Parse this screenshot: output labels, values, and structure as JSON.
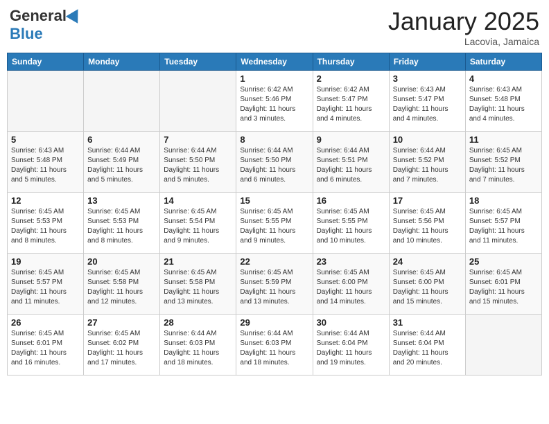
{
  "header": {
    "logo_general": "General",
    "logo_blue": "Blue",
    "month_title": "January 2025",
    "location": "Lacovia, Jamaica"
  },
  "days_of_week": [
    "Sunday",
    "Monday",
    "Tuesday",
    "Wednesday",
    "Thursday",
    "Friday",
    "Saturday"
  ],
  "weeks": [
    [
      {
        "day": "",
        "empty": true
      },
      {
        "day": "",
        "empty": true
      },
      {
        "day": "",
        "empty": true
      },
      {
        "day": "1",
        "sunrise": "6:42 AM",
        "sunset": "5:46 PM",
        "daylight": "11 hours and 3 minutes."
      },
      {
        "day": "2",
        "sunrise": "6:42 AM",
        "sunset": "5:47 PM",
        "daylight": "11 hours and 4 minutes."
      },
      {
        "day": "3",
        "sunrise": "6:43 AM",
        "sunset": "5:47 PM",
        "daylight": "11 hours and 4 minutes."
      },
      {
        "day": "4",
        "sunrise": "6:43 AM",
        "sunset": "5:48 PM",
        "daylight": "11 hours and 4 minutes."
      }
    ],
    [
      {
        "day": "5",
        "sunrise": "6:43 AM",
        "sunset": "5:48 PM",
        "daylight": "11 hours and 5 minutes."
      },
      {
        "day": "6",
        "sunrise": "6:44 AM",
        "sunset": "5:49 PM",
        "daylight": "11 hours and 5 minutes."
      },
      {
        "day": "7",
        "sunrise": "6:44 AM",
        "sunset": "5:50 PM",
        "daylight": "11 hours and 5 minutes."
      },
      {
        "day": "8",
        "sunrise": "6:44 AM",
        "sunset": "5:50 PM",
        "daylight": "11 hours and 6 minutes."
      },
      {
        "day": "9",
        "sunrise": "6:44 AM",
        "sunset": "5:51 PM",
        "daylight": "11 hours and 6 minutes."
      },
      {
        "day": "10",
        "sunrise": "6:44 AM",
        "sunset": "5:52 PM",
        "daylight": "11 hours and 7 minutes."
      },
      {
        "day": "11",
        "sunrise": "6:45 AM",
        "sunset": "5:52 PM",
        "daylight": "11 hours and 7 minutes."
      }
    ],
    [
      {
        "day": "12",
        "sunrise": "6:45 AM",
        "sunset": "5:53 PM",
        "daylight": "11 hours and 8 minutes."
      },
      {
        "day": "13",
        "sunrise": "6:45 AM",
        "sunset": "5:53 PM",
        "daylight": "11 hours and 8 minutes."
      },
      {
        "day": "14",
        "sunrise": "6:45 AM",
        "sunset": "5:54 PM",
        "daylight": "11 hours and 9 minutes."
      },
      {
        "day": "15",
        "sunrise": "6:45 AM",
        "sunset": "5:55 PM",
        "daylight": "11 hours and 9 minutes."
      },
      {
        "day": "16",
        "sunrise": "6:45 AM",
        "sunset": "5:55 PM",
        "daylight": "11 hours and 10 minutes."
      },
      {
        "day": "17",
        "sunrise": "6:45 AM",
        "sunset": "5:56 PM",
        "daylight": "11 hours and 10 minutes."
      },
      {
        "day": "18",
        "sunrise": "6:45 AM",
        "sunset": "5:57 PM",
        "daylight": "11 hours and 11 minutes."
      }
    ],
    [
      {
        "day": "19",
        "sunrise": "6:45 AM",
        "sunset": "5:57 PM",
        "daylight": "11 hours and 11 minutes."
      },
      {
        "day": "20",
        "sunrise": "6:45 AM",
        "sunset": "5:58 PM",
        "daylight": "11 hours and 12 minutes."
      },
      {
        "day": "21",
        "sunrise": "6:45 AM",
        "sunset": "5:58 PM",
        "daylight": "11 hours and 13 minutes."
      },
      {
        "day": "22",
        "sunrise": "6:45 AM",
        "sunset": "5:59 PM",
        "daylight": "11 hours and 13 minutes."
      },
      {
        "day": "23",
        "sunrise": "6:45 AM",
        "sunset": "6:00 PM",
        "daylight": "11 hours and 14 minutes."
      },
      {
        "day": "24",
        "sunrise": "6:45 AM",
        "sunset": "6:00 PM",
        "daylight": "11 hours and 15 minutes."
      },
      {
        "day": "25",
        "sunrise": "6:45 AM",
        "sunset": "6:01 PM",
        "daylight": "11 hours and 15 minutes."
      }
    ],
    [
      {
        "day": "26",
        "sunrise": "6:45 AM",
        "sunset": "6:01 PM",
        "daylight": "11 hours and 16 minutes."
      },
      {
        "day": "27",
        "sunrise": "6:45 AM",
        "sunset": "6:02 PM",
        "daylight": "11 hours and 17 minutes."
      },
      {
        "day": "28",
        "sunrise": "6:44 AM",
        "sunset": "6:03 PM",
        "daylight": "11 hours and 18 minutes."
      },
      {
        "day": "29",
        "sunrise": "6:44 AM",
        "sunset": "6:03 PM",
        "daylight": "11 hours and 18 minutes."
      },
      {
        "day": "30",
        "sunrise": "6:44 AM",
        "sunset": "6:04 PM",
        "daylight": "11 hours and 19 minutes."
      },
      {
        "day": "31",
        "sunrise": "6:44 AM",
        "sunset": "6:04 PM",
        "daylight": "11 hours and 20 minutes."
      },
      {
        "day": "",
        "empty": true
      }
    ]
  ],
  "labels": {
    "sunrise_prefix": "Sunrise: ",
    "sunset_prefix": "Sunset: ",
    "daylight_prefix": "Daylight: "
  }
}
